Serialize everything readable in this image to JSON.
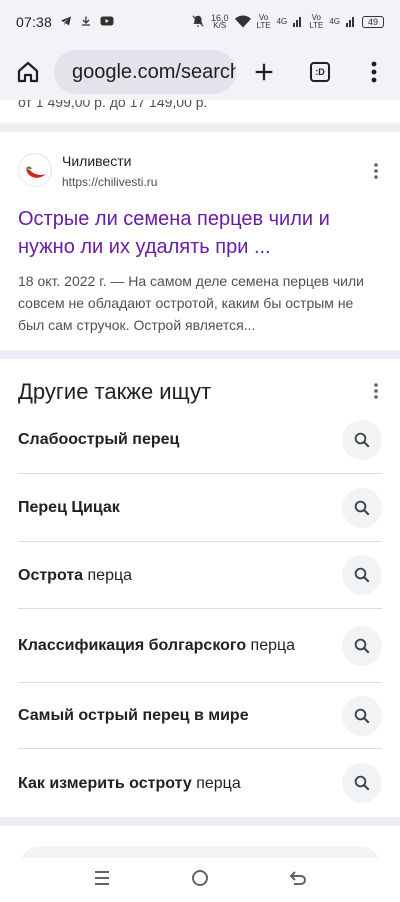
{
  "status_bar": {
    "time": "07:38",
    "speed_value": "16,0",
    "speed_unit": "K/S",
    "sim1_top": "Vo",
    "sim1_bottom": "LTE",
    "sim1_gen": "4G",
    "sim2_top": "Vo",
    "sim2_bottom": "LTE",
    "sim2_gen": "4G",
    "battery": "49"
  },
  "toolbar": {
    "url": "google.com/search",
    "tab_count": ":D"
  },
  "prev_result_cut": "от 1 499,00 р. до 17 149,00 р.",
  "result": {
    "site_name": "Чиливести",
    "site_url": "https://chilivesti.ru",
    "title": "Острые ли семена перцев чили и нужно ли их удалять при ...",
    "snippet": "18 окт. 2022 г. — На самом деле семена перцев чили совсем не обладают остротой, каким бы острым не был сам стручок. Острой является..."
  },
  "people_also_search": {
    "title": "Другие также ищут",
    "items": [
      {
        "bold": "Слабоострый перец",
        "rest": ""
      },
      {
        "bold": "Перец Цицак",
        "rest": ""
      },
      {
        "bold": "Острота",
        "rest": " перца"
      },
      {
        "bold": "Классификация болгарского",
        "rest": " перца"
      },
      {
        "bold": "Самый острый перец в мире",
        "rest": ""
      },
      {
        "bold": "Как измерить остроту",
        "rest": " перца"
      }
    ]
  },
  "colors": {
    "link_visited": "#681da8",
    "chrome_bg": "#f2f2f7",
    "omnibox_bg": "#e3e3ec",
    "separator": "#eceef4"
  }
}
